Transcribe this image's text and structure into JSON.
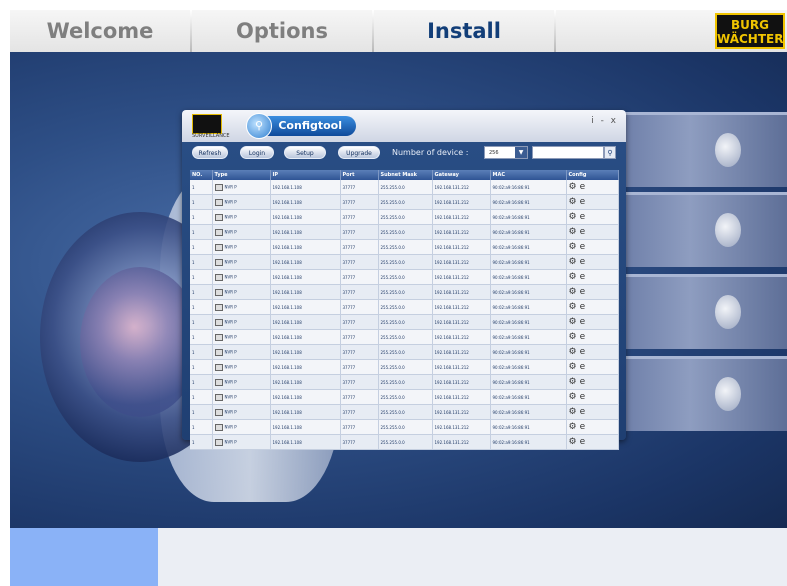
{
  "tabs": [
    {
      "label": "Welcome",
      "active": false
    },
    {
      "label": "Options",
      "active": false
    },
    {
      "label": "Install",
      "active": true
    }
  ],
  "brand": {
    "line1": "BURG",
    "line2": "WÄCHTER"
  },
  "configtool": {
    "title": "Configtool",
    "window_controls": "i - x",
    "logo_caption": "SURVEILLANCE",
    "toolbar": {
      "buttons": [
        "Refresh",
        "Login",
        "Setup",
        "Upgrade"
      ],
      "number_label": "Number of device :",
      "dropdown_value": "256",
      "search_placeholder": ""
    },
    "columns": [
      "NO.",
      "Type",
      "IP",
      "Port",
      "Subnet Mask",
      "Gateway",
      "MAC",
      "Config"
    ],
    "rows": [
      {
        "no": "1",
        "type": "NVR P",
        "ip": "192.168.1.108",
        "port": "37777",
        "mask": "255.255.0.0",
        "gateway": "192.168.131.212",
        "mac": "90:02:a9:16:86:91"
      },
      {
        "no": "1",
        "type": "NVR P",
        "ip": "192.168.1.108",
        "port": "37777",
        "mask": "255.255.0.0",
        "gateway": "192.168.131.212",
        "mac": "90:02:a9:16:86:91"
      },
      {
        "no": "1",
        "type": "NVR P",
        "ip": "192.168.1.108",
        "port": "37777",
        "mask": "255.255.0.0",
        "gateway": "192.168.131.212",
        "mac": "90:02:a9:16:86:91"
      },
      {
        "no": "1",
        "type": "NVR P",
        "ip": "192.168.1.108",
        "port": "37777",
        "mask": "255.255.0.0",
        "gateway": "192.168.131.212",
        "mac": "90:02:a9:16:86:91"
      },
      {
        "no": "1",
        "type": "NVR P",
        "ip": "192.168.1.108",
        "port": "37777",
        "mask": "255.255.0.0",
        "gateway": "192.168.131.212",
        "mac": "90:02:a9:16:86:91"
      },
      {
        "no": "1",
        "type": "NVR P",
        "ip": "192.168.1.108",
        "port": "37777",
        "mask": "255.255.0.0",
        "gateway": "192.168.131.212",
        "mac": "90:02:a9:16:86:91"
      },
      {
        "no": "1",
        "type": "NVR P",
        "ip": "192.168.1.108",
        "port": "37777",
        "mask": "255.255.0.0",
        "gateway": "192.168.131.212",
        "mac": "90:02:a9:16:86:91"
      },
      {
        "no": "1",
        "type": "NVR P",
        "ip": "192.168.1.108",
        "port": "37777",
        "mask": "255.255.0.0",
        "gateway": "192.168.131.212",
        "mac": "90:02:a9:16:86:91"
      },
      {
        "no": "1",
        "type": "NVR P",
        "ip": "192.168.1.108",
        "port": "37777",
        "mask": "255.255.0.0",
        "gateway": "192.168.131.212",
        "mac": "90:02:a9:16:86:91"
      },
      {
        "no": "1",
        "type": "NVR P",
        "ip": "192.168.1.108",
        "port": "37777",
        "mask": "255.255.0.0",
        "gateway": "192.168.131.212",
        "mac": "90:02:a9:16:86:91"
      },
      {
        "no": "1",
        "type": "NVR P",
        "ip": "192.168.1.108",
        "port": "37777",
        "mask": "255.255.0.0",
        "gateway": "192.168.131.212",
        "mac": "90:02:a9:16:86:91"
      },
      {
        "no": "1",
        "type": "NVR P",
        "ip": "192.168.1.108",
        "port": "37777",
        "mask": "255.255.0.0",
        "gateway": "192.168.131.212",
        "mac": "90:02:a9:16:86:91"
      },
      {
        "no": "1",
        "type": "NVR P",
        "ip": "192.168.1.108",
        "port": "37777",
        "mask": "255.255.0.0",
        "gateway": "192.168.131.212",
        "mac": "90:02:a9:16:86:91"
      },
      {
        "no": "1",
        "type": "NVR P",
        "ip": "192.168.1.108",
        "port": "37777",
        "mask": "255.255.0.0",
        "gateway": "192.168.131.212",
        "mac": "90:02:a9:16:86:91"
      },
      {
        "no": "1",
        "type": "NVR P",
        "ip": "192.168.1.108",
        "port": "37777",
        "mask": "255.255.0.0",
        "gateway": "192.168.131.212",
        "mac": "90:02:a9:16:86:91"
      },
      {
        "no": "1",
        "type": "NVR P",
        "ip": "192.168.1.108",
        "port": "37777",
        "mask": "255.255.0.0",
        "gateway": "192.168.131.212",
        "mac": "90:02:a9:16:86:91"
      },
      {
        "no": "1",
        "type": "NVR P",
        "ip": "192.168.1.108",
        "port": "37777",
        "mask": "255.255.0.0",
        "gateway": "192.168.131.212",
        "mac": "90:02:a9:16:86:91"
      },
      {
        "no": "1",
        "type": "NVR P",
        "ip": "192.168.1.108",
        "port": "37777",
        "mask": "255.255.0.0",
        "gateway": "192.168.131.212",
        "mac": "90:02:a9:16:86:91"
      }
    ],
    "config_icons": [
      "gear-icon",
      "browser-icon"
    ]
  },
  "colors": {
    "accent": "#123e78",
    "bottom_button": "#8ab2f7",
    "brand_yellow": "#f0c400"
  }
}
